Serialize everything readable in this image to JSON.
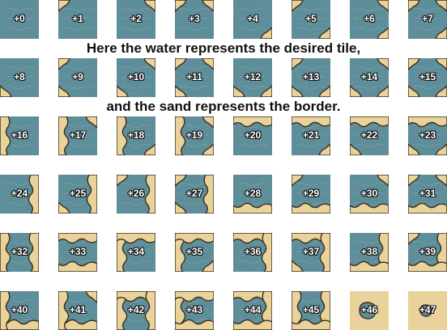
{
  "captions": {
    "line1": "Here the water represents the desired tile,",
    "line2": "and the sand represents the border."
  },
  "tile_prefix": "+",
  "tiles": [
    {
      "id": "0",
      "shape": "water"
    },
    {
      "id": "1",
      "shape": "corner-tl"
    },
    {
      "id": "2",
      "shape": "corner-tr"
    },
    {
      "id": "3",
      "shape": "corner-tl-tr"
    },
    {
      "id": "4",
      "shape": "corner-br"
    },
    {
      "id": "5",
      "shape": "corner-tl-br"
    },
    {
      "id": "6",
      "shape": "corner-tr-br"
    },
    {
      "id": "7",
      "shape": "corner-tl-tr-br"
    },
    {
      "id": "8",
      "shape": "corner-bl"
    },
    {
      "id": "9",
      "shape": "corner-tl-bl"
    },
    {
      "id": "10",
      "shape": "corner-tr-bl"
    },
    {
      "id": "11",
      "shape": "corner-tl-tr-bl"
    },
    {
      "id": "12",
      "shape": "corner-br-bl"
    },
    {
      "id": "13",
      "shape": "corner-tl-br-bl"
    },
    {
      "id": "14",
      "shape": "corner-tr-br-bl"
    },
    {
      "id": "15",
      "shape": "corner-all"
    },
    {
      "id": "16",
      "shape": "edge-l"
    },
    {
      "id": "17",
      "shape": "edge-l-tr"
    },
    {
      "id": "18",
      "shape": "edge-l-br"
    },
    {
      "id": "19",
      "shape": "edge-l-tr-br"
    },
    {
      "id": "20",
      "shape": "edge-t"
    },
    {
      "id": "21",
      "shape": "edge-t-br"
    },
    {
      "id": "22",
      "shape": "edge-t-bl"
    },
    {
      "id": "23",
      "shape": "edge-t-br-bl"
    },
    {
      "id": "24",
      "shape": "edge-r"
    },
    {
      "id": "25",
      "shape": "edge-r-bl"
    },
    {
      "id": "26",
      "shape": "edge-r-tl"
    },
    {
      "id": "27",
      "shape": "edge-r-tl-bl"
    },
    {
      "id": "28",
      "shape": "edge-b"
    },
    {
      "id": "29",
      "shape": "edge-b-tl"
    },
    {
      "id": "30",
      "shape": "edge-b-tr"
    },
    {
      "id": "31",
      "shape": "edge-b-tl-tr"
    },
    {
      "id": "32",
      "shape": "edge-l-r"
    },
    {
      "id": "33",
      "shape": "edge-t-b"
    },
    {
      "id": "34",
      "shape": "edge-l-t"
    },
    {
      "id": "35",
      "shape": "edge-l-t-br"
    },
    {
      "id": "36",
      "shape": "edge-t-r"
    },
    {
      "id": "37",
      "shape": "edge-t-r-bl"
    },
    {
      "id": "38",
      "shape": "edge-r-b"
    },
    {
      "id": "39",
      "shape": "edge-r-b-tl"
    },
    {
      "id": "40",
      "shape": "edge-b-l"
    },
    {
      "id": "41",
      "shape": "edge-b-l-tr"
    },
    {
      "id": "42",
      "shape": "edge-l-t-r"
    },
    {
      "id": "43",
      "shape": "edge-l-t-b"
    },
    {
      "id": "44",
      "shape": "edge-t-r-b"
    },
    {
      "id": "45",
      "shape": "edge-l-r-b"
    },
    {
      "id": "46",
      "shape": "island"
    },
    {
      "id": "47",
      "shape": "island-small"
    }
  ],
  "colors": {
    "water": "#5e8e9a",
    "water_light": "#7aa7b2",
    "sand": "#e9d39b",
    "sand_dark": "#c9aa62",
    "rock": "#3b2e1e",
    "caption": "#111111"
  }
}
